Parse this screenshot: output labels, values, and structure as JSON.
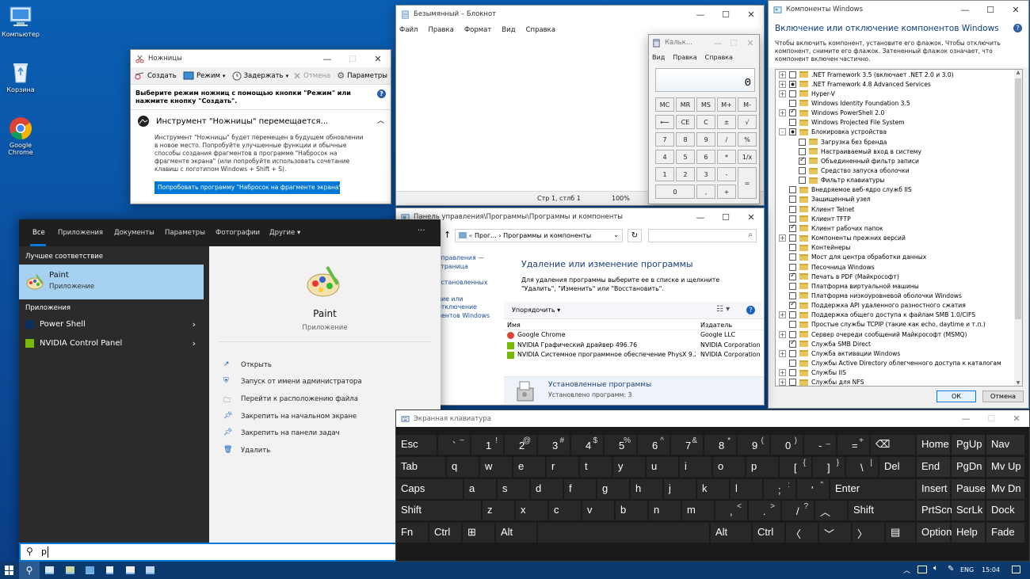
{
  "desktop": {
    "icons": [
      {
        "label": "Компьютер"
      },
      {
        "label": "Корзина"
      },
      {
        "label": "Google Chrome"
      }
    ]
  },
  "snipping": {
    "title": "Ножницы",
    "toolbar": {
      "create": "Создать",
      "mode": "Режим",
      "delay": "Задержать",
      "cancel": "Отмена",
      "options": "Параметры"
    },
    "hint": "Выберите режим ножниц с помощью кнопки \"Режим\" или нажмите кнопку \"Создать\".",
    "notice_title": "Инструмент \"Ножницы\" перемещается...",
    "notice_body": "Инструмент \"Ножницы\" будет перемещен в будущем обновлении в новое место. Попробуйте улучшенные функции и обычные способы создания фрагментов в программе \"Набросок на фрагменте экрана\" (или попробуйте использовать сочетание клавиш с логотипом Windows + Shift + S).",
    "try_button": "Попробовать программу \"Набросок на фрагменте экрана\""
  },
  "notepad": {
    "title": "Безымянный – Блокнот",
    "menu": [
      "Файл",
      "Правка",
      "Формат",
      "Вид",
      "Справка"
    ],
    "status": {
      "pos": "Стр 1, стлб 1",
      "zoom": "100%"
    }
  },
  "calculator": {
    "title": "Кальк...",
    "menu": [
      "Вид",
      "Правка",
      "Справка"
    ],
    "display": "0",
    "rows": [
      [
        "MC",
        "MR",
        "MS",
        "M+",
        "M-"
      ],
      [
        "⟵",
        "CE",
        "C",
        "±",
        "√"
      ],
      [
        "7",
        "8",
        "9",
        "/",
        "%"
      ],
      [
        "4",
        "5",
        "6",
        "*",
        "1/x"
      ],
      [
        "1",
        "2",
        "3",
        "-",
        "="
      ],
      [
        "0",
        ",",
        "+"
      ]
    ]
  },
  "features": {
    "title": "Компоненты Windows",
    "heading": "Включение или отключение компонентов Windows",
    "desc": "Чтобы включить компонент, установите его флажок. Чтобы отключить компонент, снимите его флажок. Затененный флажок означает, что компонент включен частично.",
    "items": [
      {
        "label": ".NET Framework 3.5 (включает .NET 2.0 и 3.0)",
        "exp": "+",
        "state": "off",
        "indent": 0
      },
      {
        "label": ".NET Framework 4.8 Advanced Services",
        "exp": "+",
        "state": "part",
        "indent": 0
      },
      {
        "label": "Hyper-V",
        "exp": "+",
        "state": "off",
        "indent": 0
      },
      {
        "label": "Windows Identity Foundation 3.5",
        "exp": "",
        "state": "off",
        "indent": 0
      },
      {
        "label": "Windows PowerShell 2.0",
        "exp": "+",
        "state": "on",
        "indent": 0
      },
      {
        "label": "Windows Projected File System",
        "exp": "",
        "state": "off",
        "indent": 0
      },
      {
        "label": "Блокировка устройства",
        "exp": "-",
        "state": "part",
        "indent": 0
      },
      {
        "label": "Загрузка без бренда",
        "exp": "",
        "state": "off",
        "indent": 1
      },
      {
        "label": "Настраиваемый вход в систему",
        "exp": "",
        "state": "off",
        "indent": 1
      },
      {
        "label": "Объединенный фильтр записи",
        "exp": "",
        "state": "on",
        "indent": 1
      },
      {
        "label": "Средство запуска оболочки",
        "exp": "",
        "state": "off",
        "indent": 1
      },
      {
        "label": "Фильтр клавиатуры",
        "exp": "",
        "state": "off",
        "indent": 1
      },
      {
        "label": "Внедряемое веб-ядро служб IIS",
        "exp": "",
        "state": "off",
        "indent": 0
      },
      {
        "label": "Защищенный узел",
        "exp": "",
        "state": "off",
        "indent": 0
      },
      {
        "label": "Клиент Telnet",
        "exp": "",
        "state": "off",
        "indent": 0
      },
      {
        "label": "Клиент TFTP",
        "exp": "",
        "state": "off",
        "indent": 0
      },
      {
        "label": "Клиент рабочих папок",
        "exp": "",
        "state": "on",
        "indent": 0
      },
      {
        "label": "Компоненты прежних версий",
        "exp": "+",
        "state": "off",
        "indent": 0
      },
      {
        "label": "Контейнеры",
        "exp": "",
        "state": "off",
        "indent": 0
      },
      {
        "label": "Мост для центра обработки данных",
        "exp": "",
        "state": "off",
        "indent": 0
      },
      {
        "label": "Песочница Windows",
        "exp": "",
        "state": "off",
        "indent": 0
      },
      {
        "label": "Печать в PDF (Майкрософт)",
        "exp": "",
        "state": "on",
        "indent": 0
      },
      {
        "label": "Платформа виртуальной машины",
        "exp": "",
        "state": "off",
        "indent": 0
      },
      {
        "label": "Платформа низкоуровневой оболочки Windows",
        "exp": "",
        "state": "off",
        "indent": 0
      },
      {
        "label": "Поддержка API удаленного разностного сжатия",
        "exp": "",
        "state": "on",
        "indent": 0
      },
      {
        "label": "Поддержка общего доступа к файлам SMB 1.0/CIFS",
        "exp": "+",
        "state": "off",
        "indent": 0
      },
      {
        "label": "Простые службы TCPIP (такие как echo, daytime и т.п.)",
        "exp": "",
        "state": "off",
        "indent": 0
      },
      {
        "label": "Сервер очереди сообщений Майкрософт (MSMQ)",
        "exp": "+",
        "state": "off",
        "indent": 0
      },
      {
        "label": "Служба SMB Direct",
        "exp": "",
        "state": "on",
        "indent": 0
      },
      {
        "label": "Служба активации Windows",
        "exp": "+",
        "state": "off",
        "indent": 0
      },
      {
        "label": "Службы Active Directory облегченного доступа к каталогам",
        "exp": "",
        "state": "off",
        "indent": 0
      },
      {
        "label": "Службы IIS",
        "exp": "+",
        "state": "off",
        "indent": 0
      },
      {
        "label": "Службы для NFS",
        "exp": "+",
        "state": "off",
        "indent": 0
      }
    ],
    "ok": "ОК",
    "cancel": "Отмена"
  },
  "control": {
    "title": "Панель управления\\Программы\\Программы и компоненты",
    "path": [
      "Прог...",
      "Программы и компоненты"
    ],
    "side": [
      "управления — страница",
      "установленных",
      "ние или отключение нентов Windows"
    ],
    "heading": "Удаление или изменение программы",
    "desc": "Для удаления программы выберите ее в списке и щелкните \"Удалить\", \"Изменить\" или \"Восстановить\".",
    "organize": "Упорядочить",
    "cols": [
      "Имя",
      "Издатель"
    ],
    "rows": [
      {
        "name": "Google Chrome",
        "pub": "Google LLC"
      },
      {
        "name": "NVIDIA Графический драйвер 496.76",
        "pub": "NVIDIA Corporation"
      },
      {
        "name": "NVIDIA Системное программное обеспечение PhysX 9.21...",
        "pub": "NVIDIA Corporation"
      }
    ],
    "footer_title": "Установленные программы",
    "footer_count": "Установлено программ: 3"
  },
  "search": {
    "tabs": [
      "Все",
      "Приложения",
      "Документы",
      "Параметры",
      "Фотографии",
      "Другие"
    ],
    "more": "···",
    "best_label": "Лучшее соответствие",
    "best": {
      "name": "Paint",
      "type": "Приложение"
    },
    "apps_label": "Приложения",
    "apps": [
      "Power Shell",
      "NVIDIA Control Panel"
    ],
    "detail": {
      "name": "Paint",
      "type": "Приложение"
    },
    "actions": [
      "Открыть",
      "Запуск от имени администратора",
      "Перейти к расположению файла",
      "Закрепить на начальном экране",
      "Закрепить на панели задач",
      "Удалить"
    ],
    "query": "p"
  },
  "osk": {
    "title": "Экранная клавиатура",
    "keys": [
      {
        "k": "esc",
        "m": "Esc"
      },
      {
        "k": "tilde",
        "m": "`",
        "s": "~"
      },
      {
        "k": "d1",
        "m": "1",
        "s": "!"
      },
      {
        "k": "d2",
        "m": "2",
        "s": "@"
      },
      {
        "k": "d3",
        "m": "3",
        "s": "#"
      },
      {
        "k": "d4",
        "m": "4",
        "s": "$"
      },
      {
        "k": "d5",
        "m": "5",
        "s": "%"
      },
      {
        "k": "d6",
        "m": "6",
        "s": "^"
      },
      {
        "k": "d7",
        "m": "7",
        "s": "&"
      },
      {
        "k": "d8",
        "m": "8",
        "s": "*"
      },
      {
        "k": "d9",
        "m": "9",
        "s": "("
      },
      {
        "k": "d0",
        "m": "0",
        "s": ")"
      },
      {
        "k": "minus",
        "m": "-",
        "s": "_"
      },
      {
        "k": "equal",
        "m": "=",
        "s": "+"
      },
      {
        "k": "bksp",
        "m": "⌫"
      },
      {
        "k": "tab",
        "m": "Tab"
      },
      {
        "k": "q",
        "m": "q"
      },
      {
        "k": "w",
        "m": "w"
      },
      {
        "k": "e",
        "m": "e"
      },
      {
        "k": "r",
        "m": "r"
      },
      {
        "k": "t",
        "m": "t"
      },
      {
        "k": "y",
        "m": "y"
      },
      {
        "k": "u",
        "m": "u"
      },
      {
        "k": "i",
        "m": "i"
      },
      {
        "k": "o",
        "m": "o"
      },
      {
        "k": "p",
        "m": "p"
      },
      {
        "k": "lbr",
        "m": "[",
        "s": "{"
      },
      {
        "k": "rbr",
        "m": "]",
        "s": "}"
      },
      {
        "k": "bsl",
        "m": "\\",
        "s": "|"
      },
      {
        "k": "del",
        "m": "Del"
      },
      {
        "k": "caps",
        "m": "Caps"
      },
      {
        "k": "a",
        "m": "a"
      },
      {
        "k": "s",
        "m": "s"
      },
      {
        "k": "d",
        "m": "d"
      },
      {
        "k": "f",
        "m": "f"
      },
      {
        "k": "g",
        "m": "g"
      },
      {
        "k": "h",
        "m": "h"
      },
      {
        "k": "j",
        "m": "j"
      },
      {
        "k": "k",
        "m": "k"
      },
      {
        "k": "l",
        "m": "l"
      },
      {
        "k": "semi",
        "m": ";",
        "s": ":"
      },
      {
        "k": "quote",
        "m": "'",
        "s": "\""
      },
      {
        "k": "enter",
        "m": "Enter"
      },
      {
        "k": "lshift",
        "m": "Shift"
      },
      {
        "k": "z",
        "m": "z"
      },
      {
        "k": "x",
        "m": "x"
      },
      {
        "k": "c",
        "m": "c"
      },
      {
        "k": "v",
        "m": "v"
      },
      {
        "k": "b",
        "m": "b"
      },
      {
        "k": "n",
        "m": "n"
      },
      {
        "k": "m",
        "m": "m"
      },
      {
        "k": "comma",
        "m": ",",
        "s": "<"
      },
      {
        "k": "dot",
        "m": ".",
        "s": ">"
      },
      {
        "k": "slash",
        "m": "/",
        "s": "?"
      },
      {
        "k": "up",
        "m": "︿"
      },
      {
        "k": "rshift",
        "m": "Shift"
      },
      {
        "k": "fn",
        "m": "Fn"
      },
      {
        "k": "lctrl",
        "m": "Ctrl"
      },
      {
        "k": "win",
        "m": "⊞"
      },
      {
        "k": "lalt",
        "m": "Alt"
      },
      {
        "k": "space",
        "m": ""
      },
      {
        "k": "ralt",
        "m": "Alt"
      },
      {
        "k": "rctrl",
        "m": "Ctrl"
      },
      {
        "k": "left",
        "m": "〈"
      },
      {
        "k": "down",
        "m": "﹀"
      },
      {
        "k": "right",
        "m": "〉"
      },
      {
        "k": "menu",
        "m": "▤"
      },
      {
        "k": "home",
        "m": "Home"
      },
      {
        "k": "pgup",
        "m": "PgUp"
      },
      {
        "k": "nav",
        "m": "Nav"
      },
      {
        "k": "end",
        "m": "End"
      },
      {
        "k": "pgdn",
        "m": "PgDn"
      },
      {
        "k": "mvup",
        "m": "Mv Up"
      },
      {
        "k": "insert",
        "m": "Insert"
      },
      {
        "k": "pause",
        "m": "Pause"
      },
      {
        "k": "mvdn",
        "m": "Mv Dn"
      },
      {
        "k": "prtscn",
        "m": "PrtScn"
      },
      {
        "k": "scrlk",
        "m": "ScrLk"
      },
      {
        "k": "dock",
        "m": "Dock"
      },
      {
        "k": "options",
        "m": "Options"
      },
      {
        "k": "help",
        "m": "Help"
      },
      {
        "k": "fade",
        "m": "Fade"
      }
    ]
  },
  "taskbar": {
    "lang": "ENG",
    "time": "15:04"
  },
  "colors": {
    "accent": "#0078d7",
    "desktop": "#0a5fb4",
    "search_dark": "#1f1f1f",
    "osk_bg": "#1b1b1b"
  }
}
